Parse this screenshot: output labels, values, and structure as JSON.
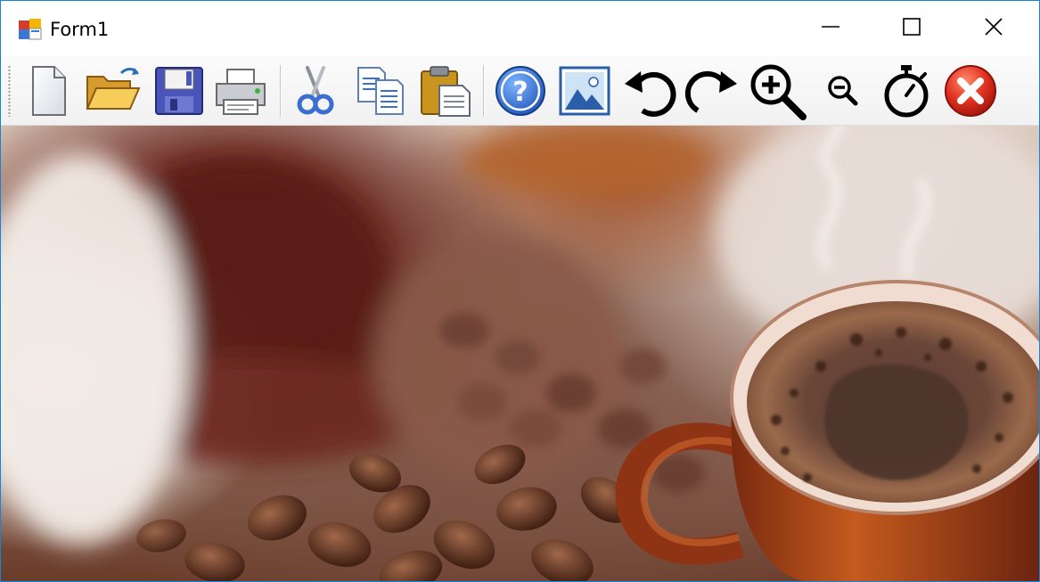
{
  "window": {
    "title": "Form1",
    "icon": "form-app-icon",
    "caption_buttons": [
      "minimize-icon",
      "maximize-icon",
      "close-icon"
    ]
  },
  "toolbar": {
    "buttons": [
      {
        "name": "new",
        "icon": "new-document-icon"
      },
      {
        "name": "open",
        "icon": "open-folder-icon"
      },
      {
        "name": "save",
        "icon": "save-disk-icon"
      },
      {
        "name": "print",
        "icon": "printer-icon"
      },
      {
        "name": "cut",
        "icon": "scissors-icon"
      },
      {
        "name": "copy",
        "icon": "copy-icon"
      },
      {
        "name": "paste",
        "icon": "paste-clipboard-icon"
      },
      {
        "name": "help",
        "icon": "help-icon"
      },
      {
        "name": "picture",
        "icon": "picture-icon"
      },
      {
        "name": "undo",
        "icon": "undo-icon"
      },
      {
        "name": "redo",
        "icon": "redo-icon"
      },
      {
        "name": "zoom-in",
        "icon": "zoom-in-icon"
      },
      {
        "name": "zoom-out",
        "icon": "zoom-out-icon"
      },
      {
        "name": "timer",
        "icon": "stopwatch-icon"
      },
      {
        "name": "exit",
        "icon": "close-red-icon"
      }
    ]
  },
  "picture_box": {
    "content": "coffee-cup-and-beans-photo"
  },
  "colors": {
    "window_border": "#1883d7",
    "toolbar_bg": "#f5f5f5",
    "exit_red": "#d7261b",
    "help_blue": "#2f6fd0"
  }
}
